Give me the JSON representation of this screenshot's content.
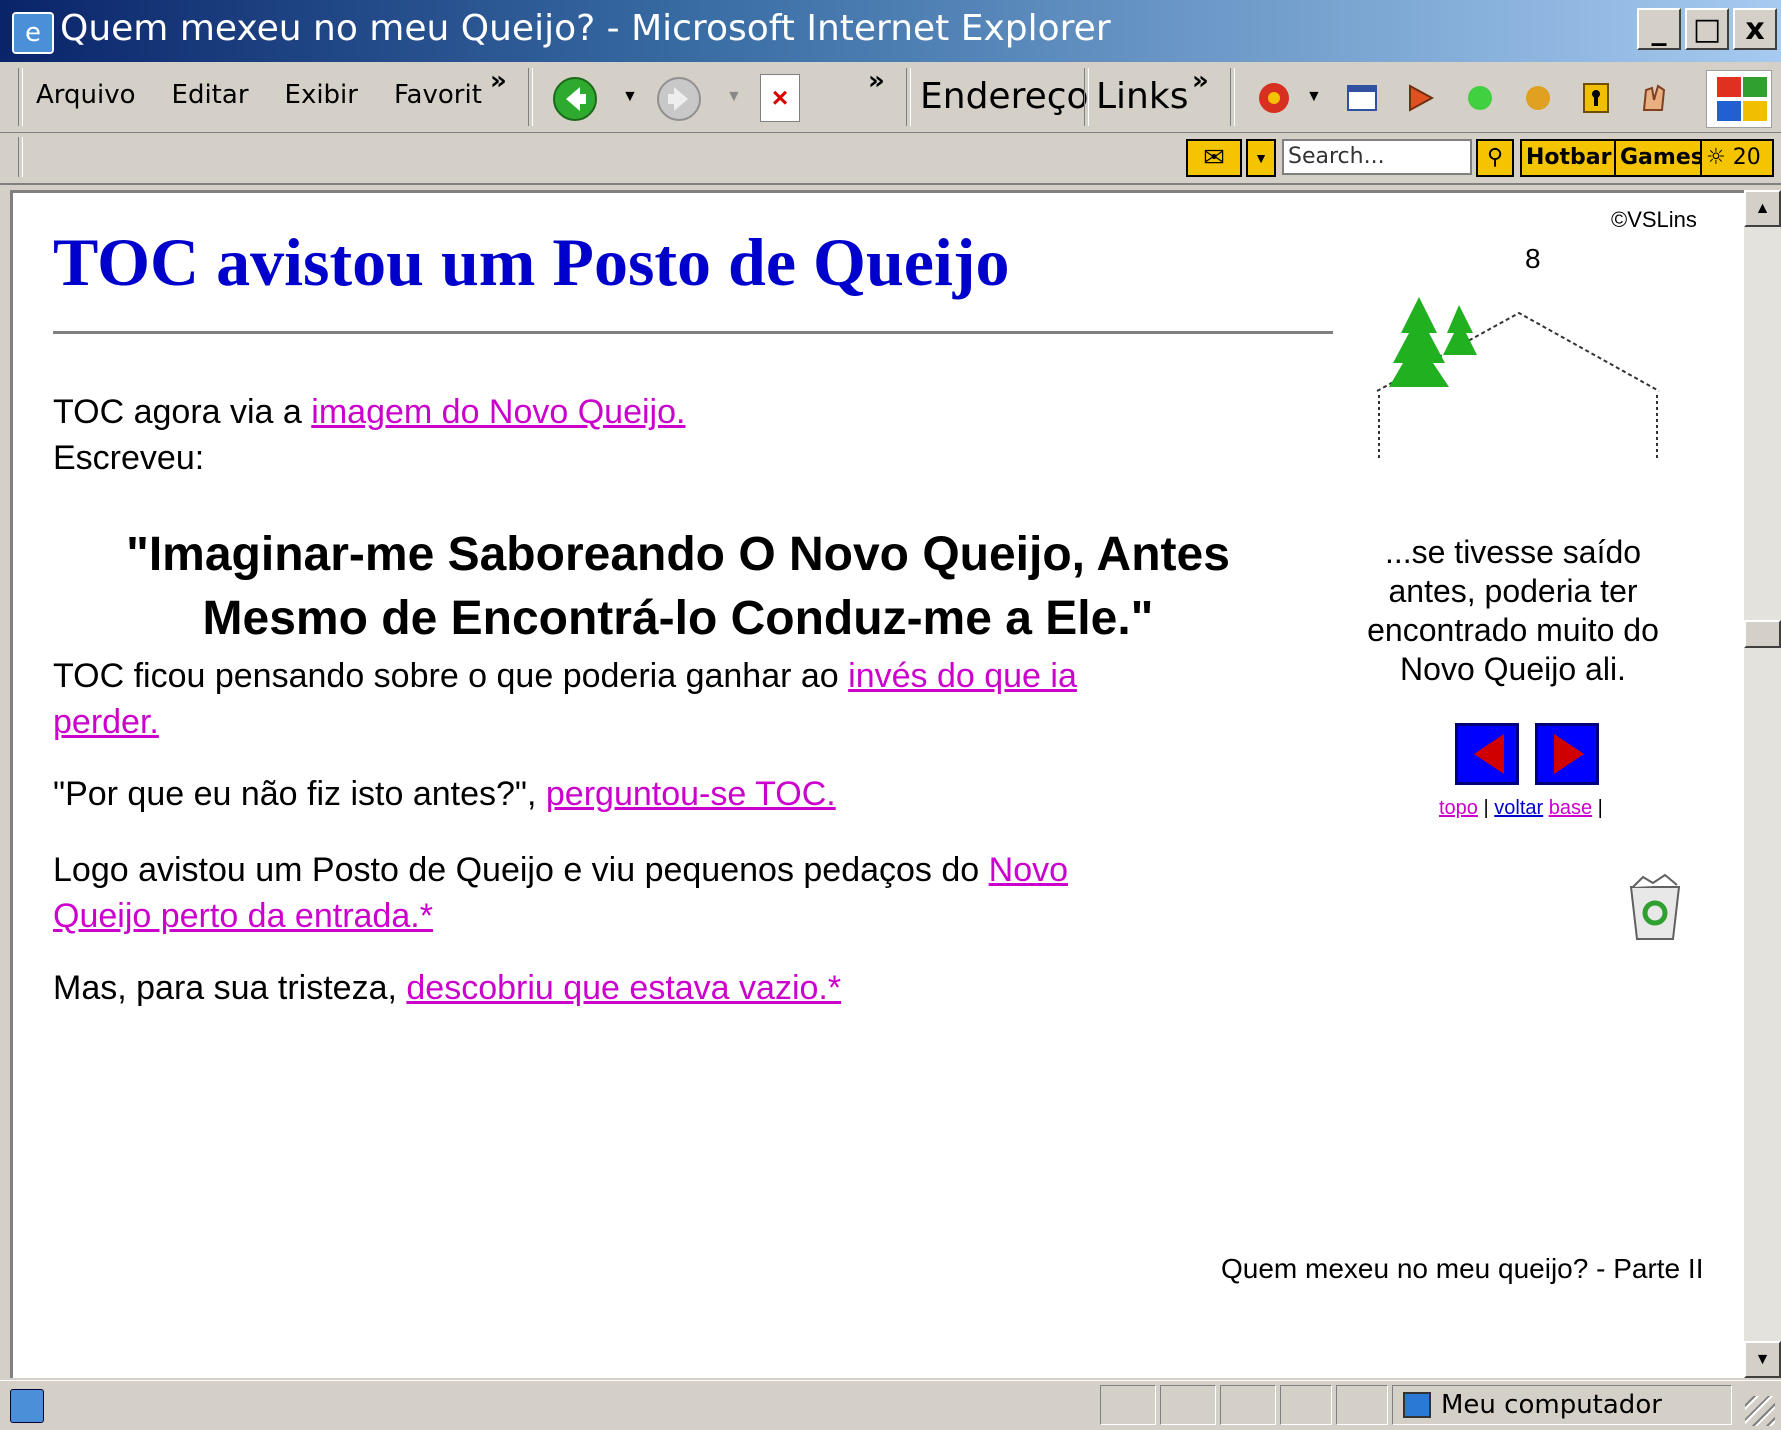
{
  "window": {
    "title": "Quem mexeu no meu Queijo? - Microsoft Internet Explorer",
    "buttons": {
      "minimize": "_",
      "maximize": "□",
      "close": "x"
    }
  },
  "menu": {
    "items": [
      "Arquivo",
      "Editar",
      "Exibir",
      "Favorit"
    ],
    "overflow": "»"
  },
  "toolbar": {
    "overflow": "»",
    "address_label": "Endereço",
    "links_label": "Links",
    "links_overflow": "»",
    "icons": [
      "back-icon",
      "forward-icon",
      "stop-icon",
      "media-icon",
      "window-icon",
      "player-icon",
      "green-dot-icon",
      "yellow-dot-icon",
      "keyhole-icon",
      "hands-icon",
      "windows-logo-icon"
    ]
  },
  "search_toolbar": {
    "search_placeholder": "Search...",
    "hotbar_label": "Hotbar",
    "games_label": "Games",
    "weather_label": "20"
  },
  "page": {
    "copyright": "©VSLins",
    "page_number": "8",
    "title": "TOC avistou um Posto de Queijo",
    "p1_text": "TOC agora via a ",
    "p1_link": "imagem do Novo Queijo.",
    "p1_line2": "Escreveu:",
    "quote": "\"Imaginar-me Saboreando O Novo Queijo, Antes Mesmo de Encontrá-lo Conduz-me a Ele.\"",
    "p2_text": "TOC ficou pensando sobre o que poderia ganhar ao ",
    "p2_link_a": "invés do que ia",
    "p2_link_b": "perder.",
    "p3_text": "\"Por que eu não fiz isto antes?\", ",
    "p3_link": "perguntou-se TOC.",
    "p4_text": "Logo avistou um Posto de Queijo e viu pequenos pedaços do ",
    "p4_link_a": "Novo",
    "p4_link_b": "Queijo perto da entrada.*",
    "p5_text": "Mas, para sua tristeza, ",
    "p5_link": "descobriu que estava vazio.*",
    "side_caption": "...se tivesse saído antes, poderia ter encontrado muito do Novo Queijo ali.",
    "nav_topo": "topo",
    "nav_sep1": "|",
    "nav_voltar": "voltar",
    "nav_base": "base",
    "nav_sep2": "|",
    "footer": "Quem mexeu no meu queijo? - Parte II"
  },
  "status": {
    "zone": "Meu computador"
  }
}
